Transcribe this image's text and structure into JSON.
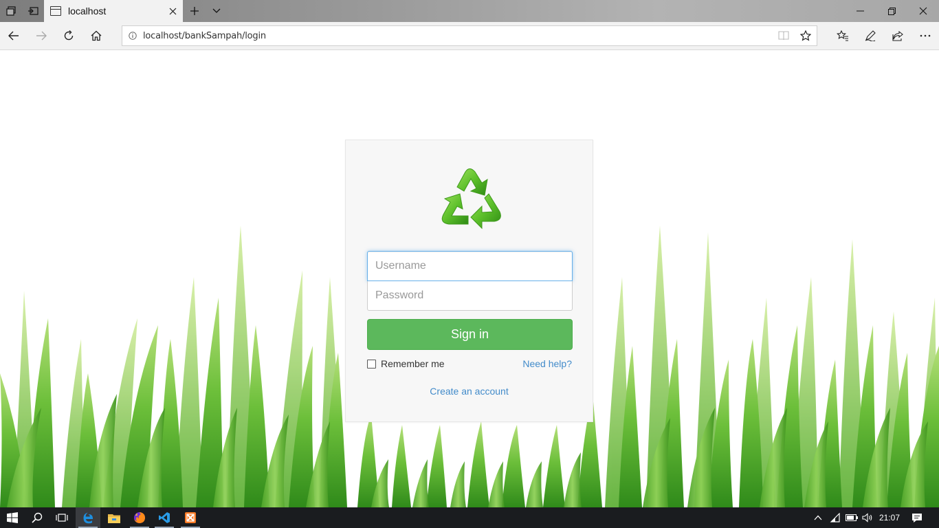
{
  "browser": {
    "tab": {
      "title": "localhost"
    },
    "address": {
      "url": "localhost/bankSampah/login"
    }
  },
  "login": {
    "username_placeholder": "Username",
    "password_placeholder": "Password",
    "signin_label": "Sign in",
    "remember_label": "Remember me",
    "remember_checked": false,
    "help_link": "Need help?",
    "create_link": "Create an account"
  },
  "taskbar": {
    "time": "21:07",
    "apps": [
      "edge-icon",
      "file-explorer-icon",
      "firefox-icon",
      "vscode-icon",
      "xampp-icon"
    ]
  },
  "colors": {
    "signin": "#5cb85c",
    "link": "#428bca",
    "focus": "#66afe9",
    "grass": "#6cbf3a"
  }
}
